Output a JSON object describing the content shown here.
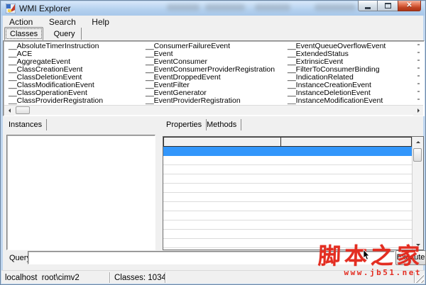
{
  "window": {
    "title": "WMI Explorer",
    "controls": {
      "minimize": "minimize",
      "maximize": "maximize",
      "close": "close"
    }
  },
  "menu": {
    "items": [
      {
        "label": "Action"
      },
      {
        "label": "Search"
      },
      {
        "label": "Help"
      }
    ]
  },
  "main_tabs": [
    {
      "label": "Classes",
      "selected": true
    },
    {
      "label": "Query",
      "selected": false
    }
  ],
  "class_list": {
    "columns": [
      [
        "__AbsoluteTimerInstruction",
        "__ACE",
        "__AggregateEvent",
        "__ClassCreationEvent",
        "__ClassDeletionEvent",
        "__ClassModificationEvent",
        "__ClassOperationEvent",
        "__ClassProviderRegistration"
      ],
      [
        "__ConsumerFailureEvent",
        "__Event",
        "__EventConsumer",
        "__EventConsumerProviderRegistration",
        "__EventDroppedEvent",
        "__EventFilter",
        "__EventGenerator",
        "__EventProviderRegistration"
      ],
      [
        "__EventQueueOverflowEvent",
        "__ExtendedStatus",
        "__ExtrinsicEvent",
        "__FilterToConsumerBinding",
        "__IndicationRelated",
        "__InstanceCreationEvent",
        "__InstanceDeletionEvent",
        "__InstanceModificationEvent"
      ]
    ]
  },
  "instances_panel": {
    "label": "Instances",
    "items": []
  },
  "detail_tabs": [
    {
      "label": "Properties",
      "selected": true
    },
    {
      "label": "Methods",
      "selected": false
    }
  ],
  "properties_grid": {
    "column_headers": [
      "",
      ""
    ],
    "row_count": 11,
    "selected_row_index": 0,
    "selection_color": "#3296fb"
  },
  "query_bar": {
    "label": "Query",
    "value": "",
    "execute_label": "Execute"
  },
  "status_bar": {
    "panels": [
      {
        "text": "localhost  root\\cimv2"
      },
      {
        "text": "Classes: 1034"
      },
      {
        "text": ""
      }
    ]
  },
  "watermark": {
    "title": "脚本之家",
    "url": "www.jb51.net",
    "color": "#e32d21"
  },
  "colors": {
    "titlebar": "#bdd7f2",
    "selection": "#3296fb",
    "frame": "#bfd6ef"
  }
}
